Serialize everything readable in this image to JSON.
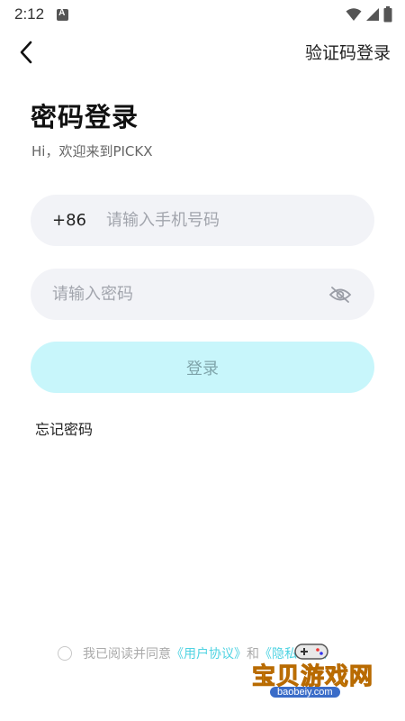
{
  "status_bar": {
    "time": "2:12",
    "icons": [
      "notification-icon",
      "wifi-icon",
      "signal-icon",
      "battery-icon"
    ]
  },
  "header": {
    "back_icon": "chevron-left-icon",
    "switch_link": "验证码登录"
  },
  "page": {
    "title": "密码登录",
    "subtitle": "Hi，欢迎来到PICKX"
  },
  "form": {
    "country_code": "+86",
    "phone_placeholder": "请输入手机号码",
    "phone_value": "",
    "password_placeholder": "请输入密码",
    "password_value": "",
    "password_toggle_icon": "eye-off-icon",
    "login_label": "登录",
    "forgot_label": "忘记密码"
  },
  "agreement": {
    "prefix": "我已阅读并同意",
    "user_agreement": "《用户协议》",
    "and": "和",
    "privacy_policy": "《隐私政策》"
  },
  "watermark": {
    "title": "宝贝游戏网",
    "url": "baobeiy.com"
  },
  "colors": {
    "accent": "#4fd3e2",
    "button_bg": "#c8f6fb",
    "field_bg": "#f2f3f7"
  }
}
